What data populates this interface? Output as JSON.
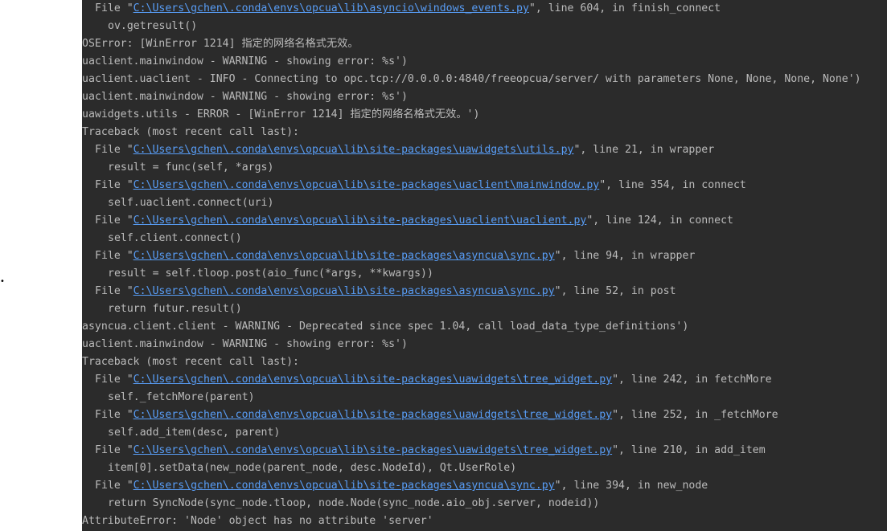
{
  "bullet": "•",
  "console": {
    "lines": [
      {
        "indent": 1,
        "kind": "frame",
        "pre": "File \"",
        "link": "C:\\Users\\gchen\\.conda\\envs\\opcua\\lib\\asyncio\\windows_events.py",
        "post": "\", line 604, in finish_connect"
      },
      {
        "indent": 2,
        "kind": "text",
        "text": "ov.getresult()"
      },
      {
        "indent": 0,
        "kind": "text",
        "text": "OSError: [WinError 1214] 指定的网络名格式无效。"
      },
      {
        "indent": 0,
        "kind": "text",
        "text": "uaclient.mainwindow - WARNING - showing error: %s')"
      },
      {
        "indent": 0,
        "kind": "text",
        "text": "uaclient.uaclient - INFO - Connecting to opc.tcp://0.0.0.0:4840/freeopcua/server/ with parameters None, None, None, None')"
      },
      {
        "indent": 0,
        "kind": "text",
        "text": "uaclient.mainwindow - WARNING - showing error: %s')"
      },
      {
        "indent": 0,
        "kind": "text",
        "text": "uawidgets.utils - ERROR - [WinError 1214] 指定的网络名格式无效。')"
      },
      {
        "indent": 0,
        "kind": "text",
        "text": "Traceback (most recent call last):"
      },
      {
        "indent": 1,
        "kind": "frame",
        "pre": "File \"",
        "link": "C:\\Users\\gchen\\.conda\\envs\\opcua\\lib\\site-packages\\uawidgets\\utils.py",
        "post": "\", line 21, in wrapper"
      },
      {
        "indent": 2,
        "kind": "text",
        "text": "result = func(self, *args)"
      },
      {
        "indent": 1,
        "kind": "frame",
        "pre": "File \"",
        "link": "C:\\Users\\gchen\\.conda\\envs\\opcua\\lib\\site-packages\\uaclient\\mainwindow.py",
        "post": "\", line 354, in connect"
      },
      {
        "indent": 2,
        "kind": "text",
        "text": "self.uaclient.connect(uri)"
      },
      {
        "indent": 1,
        "kind": "frame",
        "pre": "File \"",
        "link": "C:\\Users\\gchen\\.conda\\envs\\opcua\\lib\\site-packages\\uaclient\\uaclient.py",
        "post": "\", line 124, in connect"
      },
      {
        "indent": 2,
        "kind": "text",
        "text": "self.client.connect()"
      },
      {
        "indent": 1,
        "kind": "frame",
        "pre": "File \"",
        "link": "C:\\Users\\gchen\\.conda\\envs\\opcua\\lib\\site-packages\\asyncua\\sync.py",
        "post": "\", line 94, in wrapper"
      },
      {
        "indent": 2,
        "kind": "text",
        "text": "result = self.tloop.post(aio_func(*args, **kwargs))"
      },
      {
        "indent": 1,
        "kind": "frame",
        "pre": "File \"",
        "link": "C:\\Users\\gchen\\.conda\\envs\\opcua\\lib\\site-packages\\asyncua\\sync.py",
        "post": "\", line 52, in post"
      },
      {
        "indent": 2,
        "kind": "text",
        "text": "return futur.result()"
      },
      {
        "indent": 0,
        "kind": "text",
        "text": "asyncua.client.client - WARNING - Deprecated since spec 1.04, call load_data_type_definitions')"
      },
      {
        "indent": 0,
        "kind": "text",
        "text": "uaclient.mainwindow - WARNING - showing error: %s')"
      },
      {
        "indent": 0,
        "kind": "text",
        "text": "Traceback (most recent call last):"
      },
      {
        "indent": 1,
        "kind": "frame",
        "pre": "File \"",
        "link": "C:\\Users\\gchen\\.conda\\envs\\opcua\\lib\\site-packages\\uawidgets\\tree_widget.py",
        "post": "\", line 242, in fetchMore"
      },
      {
        "indent": 2,
        "kind": "text",
        "text": "self._fetchMore(parent)"
      },
      {
        "indent": 1,
        "kind": "frame",
        "pre": "File \"",
        "link": "C:\\Users\\gchen\\.conda\\envs\\opcua\\lib\\site-packages\\uawidgets\\tree_widget.py",
        "post": "\", line 252, in _fetchMore"
      },
      {
        "indent": 2,
        "kind": "text",
        "text": "self.add_item(desc, parent)"
      },
      {
        "indent": 1,
        "kind": "frame",
        "pre": "File \"",
        "link": "C:\\Users\\gchen\\.conda\\envs\\opcua\\lib\\site-packages\\uawidgets\\tree_widget.py",
        "post": "\", line 210, in add_item"
      },
      {
        "indent": 2,
        "kind": "text",
        "text": "item[0].setData(new_node(parent_node, desc.NodeId), Qt.UserRole)"
      },
      {
        "indent": 1,
        "kind": "frame",
        "pre": "File \"",
        "link": "C:\\Users\\gchen\\.conda\\envs\\opcua\\lib\\site-packages\\asyncua\\sync.py",
        "post": "\", line 394, in new_node"
      },
      {
        "indent": 2,
        "kind": "text",
        "text": "return SyncNode(sync_node.tloop, node.Node(sync_node.aio_obj.server, nodeid))"
      },
      {
        "indent": 0,
        "kind": "text",
        "text": "AttributeError: 'Node' object has no attribute 'server'"
      }
    ]
  },
  "colors": {
    "console_bg": "#2b2b2b",
    "console_text": "#bbbbbb",
    "link": "#589df6"
  }
}
